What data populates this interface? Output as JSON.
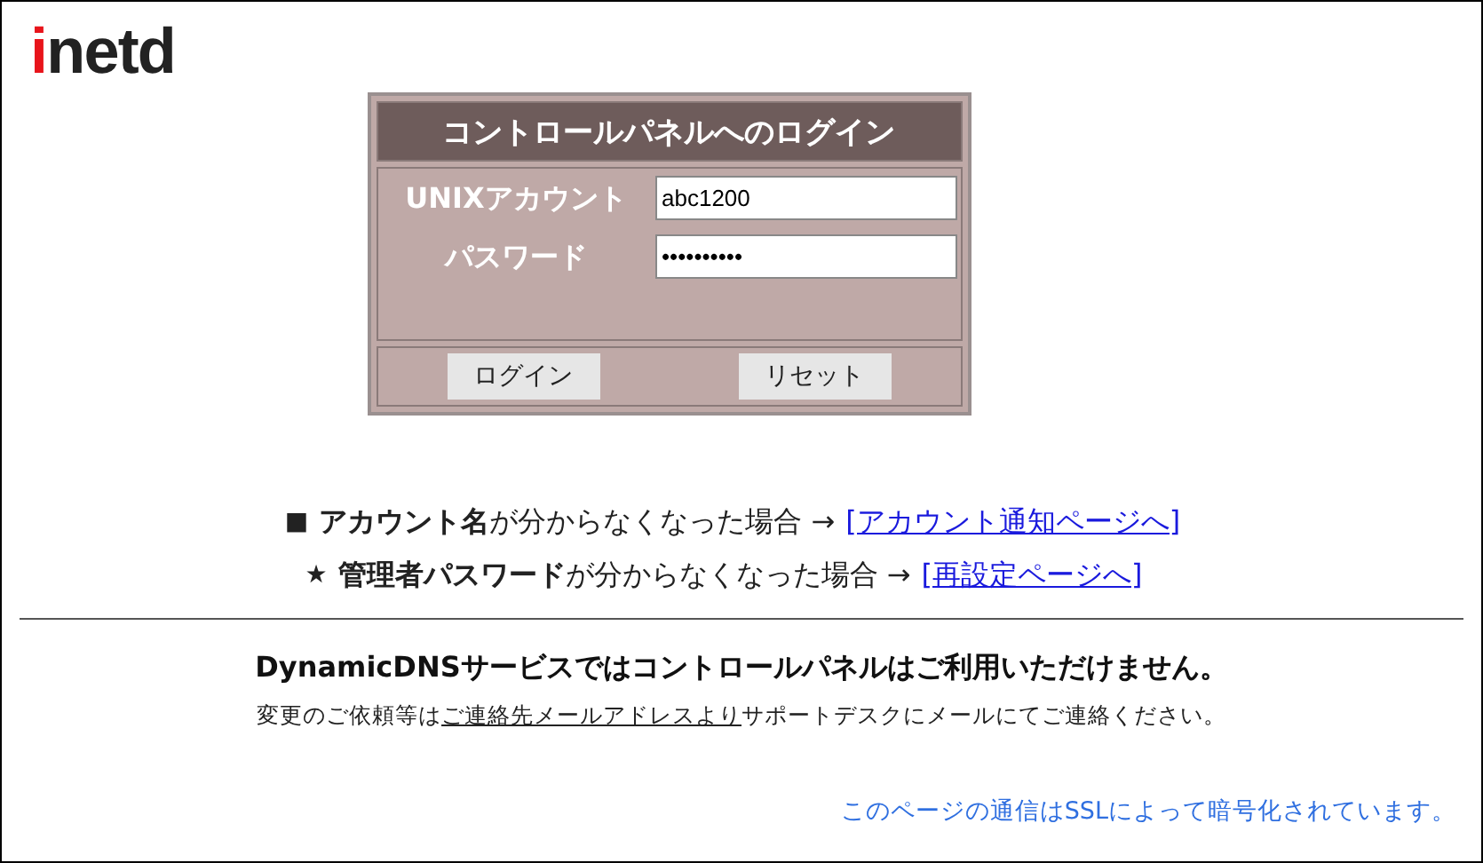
{
  "logo": {
    "accent": "i",
    "rest": "netd"
  },
  "login_panel": {
    "title": "コントロールパネルへのログイン",
    "fields": [
      {
        "label": "UNIXアカウント",
        "value": "abc1200"
      },
      {
        "label": "パスワード",
        "value": "••••••••••"
      }
    ],
    "buttons": [
      "ログイン",
      "リセット"
    ]
  },
  "notices": [
    {
      "bullet": "■",
      "text": "**アカウント名**が分からなくなった場合 →",
      "link": "[アカウント通知ページへ]"
    },
    {
      "bullet": "★",
      "text": "**管理者パスワード**が分からなくなった場合 →",
      "link": "[再設定ページへ]"
    }
  ],
  "dns_notice": {
    "heading": "DynamicDNSサービスではコントロールパネルはご利用いただけません。",
    "before": "変更のご依頼等は",
    "link": "ご連絡先メールアドレスより",
    "after": "サポートデスクにメールにてご連絡ください。"
  },
  "ssl_note": "このページの通信はSSLによって暗号化されています。"
}
